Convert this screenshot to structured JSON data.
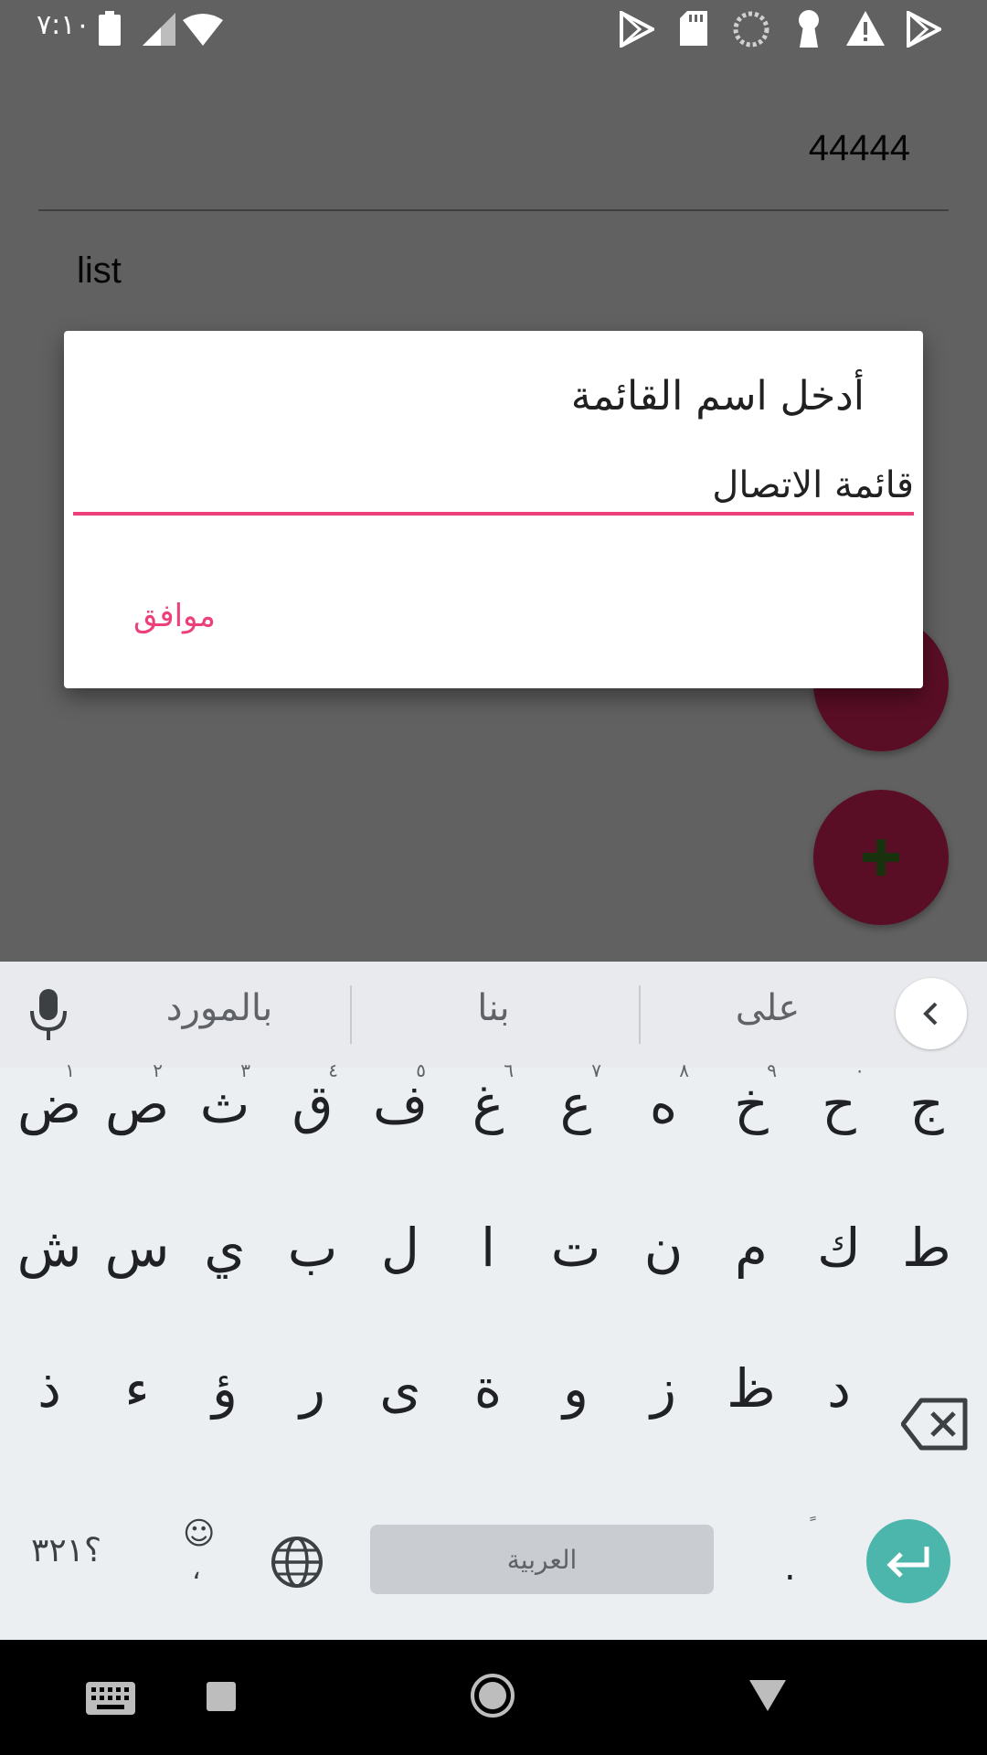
{
  "status_bar": {
    "time": "٧:١٠"
  },
  "app": {
    "number_value": "44444",
    "list_label": "list"
  },
  "dialog": {
    "title": "أدخل اسم القائمة",
    "input_value": "قائمة الاتصال",
    "ok_label": "موافق"
  },
  "keyboard": {
    "suggestions": [
      "بالمورد",
      "بنا",
      "على"
    ],
    "rows": [
      [
        {
          "char": "ض",
          "hint": "١"
        },
        {
          "char": "ص",
          "hint": "٢"
        },
        {
          "char": "ث",
          "hint": "٣"
        },
        {
          "char": "ق",
          "hint": "٤"
        },
        {
          "char": "ف",
          "hint": "٥"
        },
        {
          "char": "غ",
          "hint": "٦"
        },
        {
          "char": "ع",
          "hint": "٧"
        },
        {
          "char": "ه",
          "hint": "٨"
        },
        {
          "char": "خ",
          "hint": "٩"
        },
        {
          "char": "ح",
          "hint": "٠"
        },
        {
          "char": "ج",
          "hint": ""
        }
      ],
      [
        {
          "char": "ش"
        },
        {
          "char": "س"
        },
        {
          "char": "ي"
        },
        {
          "char": "ب"
        },
        {
          "char": "ل"
        },
        {
          "char": "ا"
        },
        {
          "char": "ت"
        },
        {
          "char": "ن"
        },
        {
          "char": "م"
        },
        {
          "char": "ك"
        },
        {
          "char": "ط"
        }
      ],
      [
        {
          "char": "ذ"
        },
        {
          "char": "ء"
        },
        {
          "char": "ؤ"
        },
        {
          "char": "ر"
        },
        {
          "char": "ى"
        },
        {
          "char": "ة"
        },
        {
          "char": "و"
        },
        {
          "char": "ز"
        },
        {
          "char": "ظ"
        },
        {
          "char": "د"
        }
      ]
    ],
    "symbols_key": "؟٣٢١",
    "emoji_key_face": "☺",
    "emoji_key_comma": "،",
    "space_label": "العربية",
    "period_char": ".",
    "period_alt_mark": "ً"
  },
  "colors": {
    "accent_pink": "#ec407a",
    "fab_red": "#e0245e",
    "enter_teal": "#4db6ac"
  },
  "icons": {
    "status": [
      "battery-icon",
      "signal-icon",
      "wifi-icon",
      "play-store-icon",
      "sd-card-icon",
      "sync-icon",
      "keyhole-icon",
      "warning-icon",
      "play-store-icon"
    ],
    "keyboard": [
      "mic-icon",
      "chevron-left-icon",
      "backspace-icon",
      "globe-icon",
      "enter-icon"
    ],
    "nav": [
      "keyboard-icon",
      "recents-icon",
      "home-icon",
      "back-icon"
    ]
  }
}
